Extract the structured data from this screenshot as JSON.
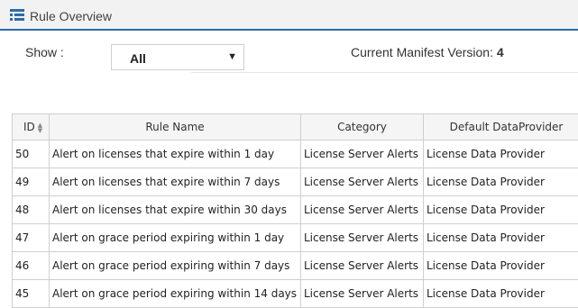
{
  "window": {
    "title": "Rule Overview",
    "icon": "list-icon"
  },
  "toolbar": {
    "show_label": "Show :",
    "show_select": {
      "value": "All"
    },
    "manifest_label": "Current Manifest Version:",
    "manifest_value": "4"
  },
  "table": {
    "columns": [
      "ID",
      "Rule Name",
      "Category",
      "Default DataProvider"
    ],
    "rows": [
      [
        "50",
        "Alert on licenses that expire within 1 day",
        "License Server Alerts",
        "License Data Provider"
      ],
      [
        "49",
        "Alert on licenses that expire within 7 days",
        "License Server Alerts",
        "License Data Provider"
      ],
      [
        "48",
        "Alert on licenses that expire within 30 days",
        "License Server Alerts",
        "License Data Provider"
      ],
      [
        "47",
        "Alert on grace period expiring within 1 day",
        "License Server Alerts",
        "License Data Provider"
      ],
      [
        "46",
        "Alert on grace period expiring within 7 days",
        "License Server Alerts",
        "License Data Provider"
      ],
      [
        "45",
        "Alert on grace period expiring within 14 days",
        "License Server Alerts",
        "License Data Provider"
      ]
    ]
  },
  "colors": {
    "accent": "#2d6ca7",
    "header_bg": "#f5f5f5",
    "border": "#cfcfcf"
  }
}
